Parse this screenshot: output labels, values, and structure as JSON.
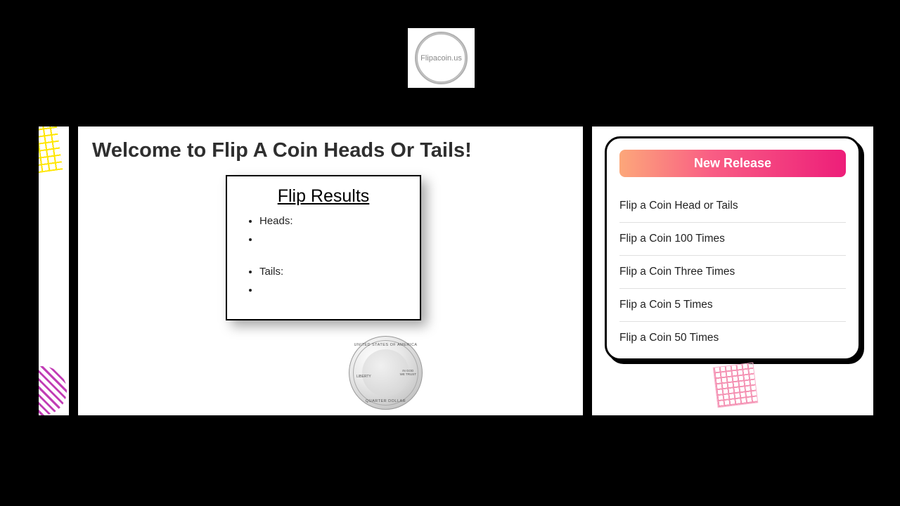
{
  "logo": {
    "text": "Flipacoin.us"
  },
  "main": {
    "title": "Welcome to Flip A Coin Heads Or Tails!",
    "results_title": "Flip Results",
    "heads_label": "Heads:",
    "heads_value": "",
    "tails_label": "Tails:",
    "tails_value": "",
    "coin": {
      "top": "UNITED STATES OF AMERICA",
      "bottom": "QUARTER DOLLAR",
      "left": "LIBERTY",
      "right_top": "IN GOD",
      "right_bot": "WE TRUST"
    }
  },
  "sidebar": {
    "header": "New Release",
    "items": [
      {
        "label": "Flip a Coin Head or Tails"
      },
      {
        "label": "Flip a Coin 100 Times"
      },
      {
        "label": "Flip a Coin Three Times"
      },
      {
        "label": "Flip a Coin 5 Times"
      },
      {
        "label": "Flip a Coin 50 Times"
      }
    ]
  }
}
